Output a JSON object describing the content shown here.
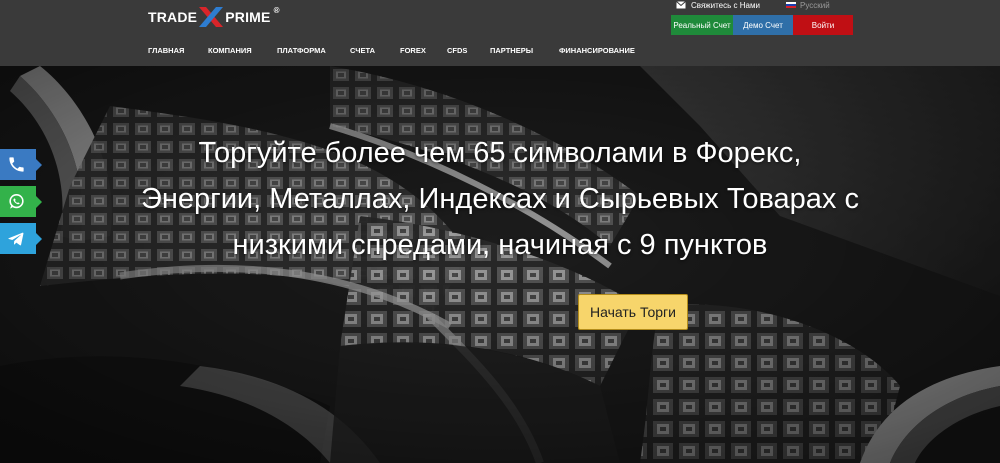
{
  "brand": {
    "word1": "TRADE",
    "word2": "PRIME",
    "reg": "®"
  },
  "nav": {
    "items": [
      {
        "label": "ГЛАВНАЯ"
      },
      {
        "label": "КОМПАНИЯ"
      },
      {
        "label": "ПЛАТФОРМА"
      },
      {
        "label": "СЧЕТА"
      },
      {
        "label": "FOREX"
      },
      {
        "label": "CFDS"
      },
      {
        "label": "ПАРТНЕРЫ"
      },
      {
        "label": "ФИНАНСИРОВАНИЕ"
      }
    ]
  },
  "topbar": {
    "contact_label": "Свяжитесь с Нами",
    "language_label": "Русский",
    "real_account": "Реальный Счет",
    "demo_account": "Демо Счет",
    "login": "Войти"
  },
  "hero": {
    "line1": "Торгуйте более чем 65 символами в Форекс,",
    "line2": "Энергии, Металлах, Индексах и Сырьевых Товарах с",
    "line3": "низкими спредами, начиная с 9 пунктов",
    "cta": "Начать Торги"
  },
  "side_tabs": {
    "phone": "phone-icon",
    "whatsapp": "whatsapp-icon",
    "telegram": "telegram-icon"
  },
  "colors": {
    "header_bg": "#3a3a3a",
    "real_account": "#1f8a3a",
    "demo_account": "#2f6fa8",
    "login": "#c00f14",
    "cta": "#f7d56b",
    "logo_x_red": "#d9252a",
    "logo_x_blue": "#2e7dd1"
  }
}
